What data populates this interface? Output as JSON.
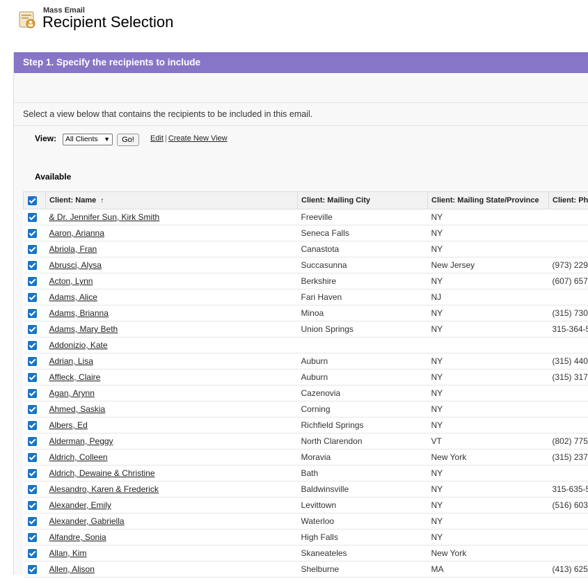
{
  "header": {
    "subtitle": "Mass Email",
    "title": "Recipient Selection"
  },
  "step": {
    "title": "Step 1. Specify the recipients to include"
  },
  "instructions": "Select a view below that contains the recipients to be included in this email.",
  "view": {
    "label": "View:",
    "selected": "All Clients",
    "go_label": "Go!",
    "edit_label": "Edit",
    "separator": "|",
    "create_label": "Create New View"
  },
  "available_label": "Available",
  "table": {
    "columns": {
      "name": "Client: Name",
      "sort_indicator": "↑",
      "city": "Client: Mailing City",
      "state": "Client: Mailing State/Province",
      "phone": "Client: Phone"
    },
    "rows": [
      {
        "name": "& Dr. Jennifer Sun, Kirk Smith",
        "city": "Freeville",
        "state": "NY",
        "phone": ""
      },
      {
        "name": "Aaron, Arianna",
        "city": "Seneca Falls",
        "state": "NY",
        "phone": ""
      },
      {
        "name": "Abriola, Fran",
        "city": "Canastota",
        "state": "NY",
        "phone": ""
      },
      {
        "name": "Abrusci, Alysa",
        "city": "Succasunna",
        "state": "New Jersey",
        "phone": "(973) 229"
      },
      {
        "name": "Acton, Lynn",
        "city": "Berkshire",
        "state": "NY",
        "phone": "(607) 657"
      },
      {
        "name": "Adams, Alice",
        "city": "Fari Haven",
        "state": "NJ",
        "phone": ""
      },
      {
        "name": "Adams, Brianna",
        "city": "Minoa",
        "state": "NY",
        "phone": "(315) 730"
      },
      {
        "name": "Adams, Mary Beth",
        "city": "Union Springs",
        "state": "NY",
        "phone": "315-364-5"
      },
      {
        "name": "Addonizio, Kate",
        "city": "",
        "state": "",
        "phone": ""
      },
      {
        "name": "Adrian, Lisa",
        "city": "Auburn",
        "state": "NY",
        "phone": "(315) 440"
      },
      {
        "name": "Affleck, Claire",
        "city": "Auburn",
        "state": "NY",
        "phone": "(315) 317"
      },
      {
        "name": "Agan, Arynn",
        "city": "Cazenovia",
        "state": "NY",
        "phone": ""
      },
      {
        "name": "Ahmed, Saskia",
        "city": "Corning",
        "state": "NY",
        "phone": ""
      },
      {
        "name": "Albers, Ed",
        "city": "Richfield Springs",
        "state": "NY",
        "phone": ""
      },
      {
        "name": "Alderman, Peggy",
        "city": "North Clarendon",
        "state": "VT",
        "phone": "(802) 775"
      },
      {
        "name": "Aldrich, Colleen",
        "city": "Moravia",
        "state": "New York",
        "phone": "(315) 237"
      },
      {
        "name": "Aldrich, Dewaine & Christine",
        "city": "Bath",
        "state": "NY",
        "phone": ""
      },
      {
        "name": "Alesandro, Karen & Frederick",
        "city": "Baldwinsville",
        "state": "NY",
        "phone": "315-635-5"
      },
      {
        "name": "Alexander, Emily",
        "city": "Levittown",
        "state": "NY",
        "phone": "(516) 603"
      },
      {
        "name": "Alexander, Gabriella",
        "city": "Waterloo",
        "state": "NY",
        "phone": ""
      },
      {
        "name": "Alfandre, Sonia",
        "city": "High Falls",
        "state": "NY",
        "phone": ""
      },
      {
        "name": "Allan, Kim",
        "city": "Skaneateles",
        "state": "New York",
        "phone": ""
      },
      {
        "name": "Allen, Alison",
        "city": "Shelburne",
        "state": "MA",
        "phone": "(413) 625"
      }
    ]
  }
}
